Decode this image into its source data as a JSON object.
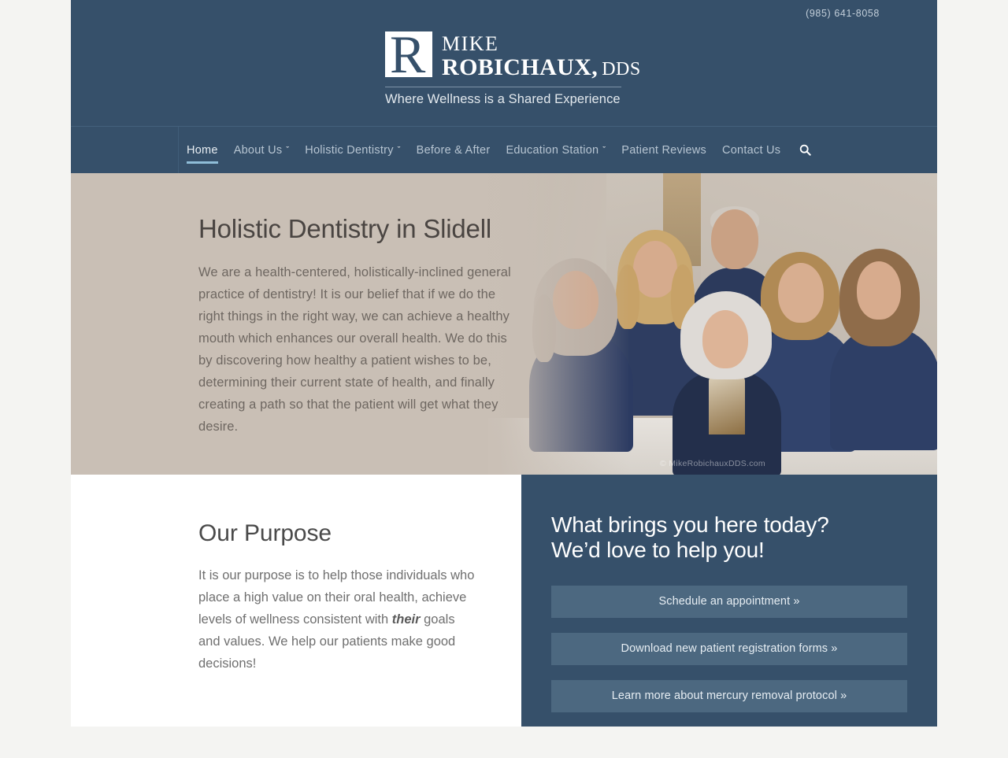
{
  "header": {
    "phone": "(985) 641-8058",
    "logo": {
      "mark_letter": "R",
      "first_name": "MIKE",
      "last_name": "ROBICHAUX,",
      "credential": "DDS",
      "tagline": "Where Wellness is a Shared Experience"
    }
  },
  "nav": {
    "items": [
      {
        "label": "Home",
        "caret": "",
        "active": true
      },
      {
        "label": "About Us",
        "caret": "ˇ",
        "active": false
      },
      {
        "label": "Holistic Dentistry",
        "caret": "ˇ",
        "active": false
      },
      {
        "label": "Before & After",
        "caret": "",
        "active": false
      },
      {
        "label": "Education Station",
        "caret": "ˇ",
        "active": false
      },
      {
        "label": "Patient Reviews",
        "caret": "",
        "active": false
      },
      {
        "label": "Contact Us",
        "caret": "",
        "active": false
      }
    ],
    "search_icon": "search-icon"
  },
  "hero": {
    "heading": "Holistic Dentistry in Slidell",
    "paragraph": "We are a health-centered, holistically-inclined general practice of dentistry! It is our belief that if we do the right things in the right way, we can achieve a healthy mouth which enhances our overall health. We do this by discovering how healthy a patient wishes to be, determining their current state of health, and finally creating a path so that the patient will get what they desire.",
    "photo_alt": "dental-team-group-photo",
    "watermark": "© MikeRobichauxDDS.com",
    "background_color": "#c9bfb5"
  },
  "purpose": {
    "heading": "Our Purpose",
    "paragraph_part1": "It is our purpose is to help those individuals who place a high value on their oral health, achieve levels of wellness consistent with ",
    "emphasis": "their",
    "paragraph_part2": " goals and values. We help our patients make good decisions!"
  },
  "cta": {
    "heading_line1": "What brings you here today?",
    "heading_line2": "We’d love to help you!",
    "buttons": [
      "Schedule an appointment »",
      "Download new patient registration forms »",
      "Learn more about mercury removal protocol »"
    ],
    "panel_color": "#36506a",
    "button_color": "#4c6880"
  }
}
